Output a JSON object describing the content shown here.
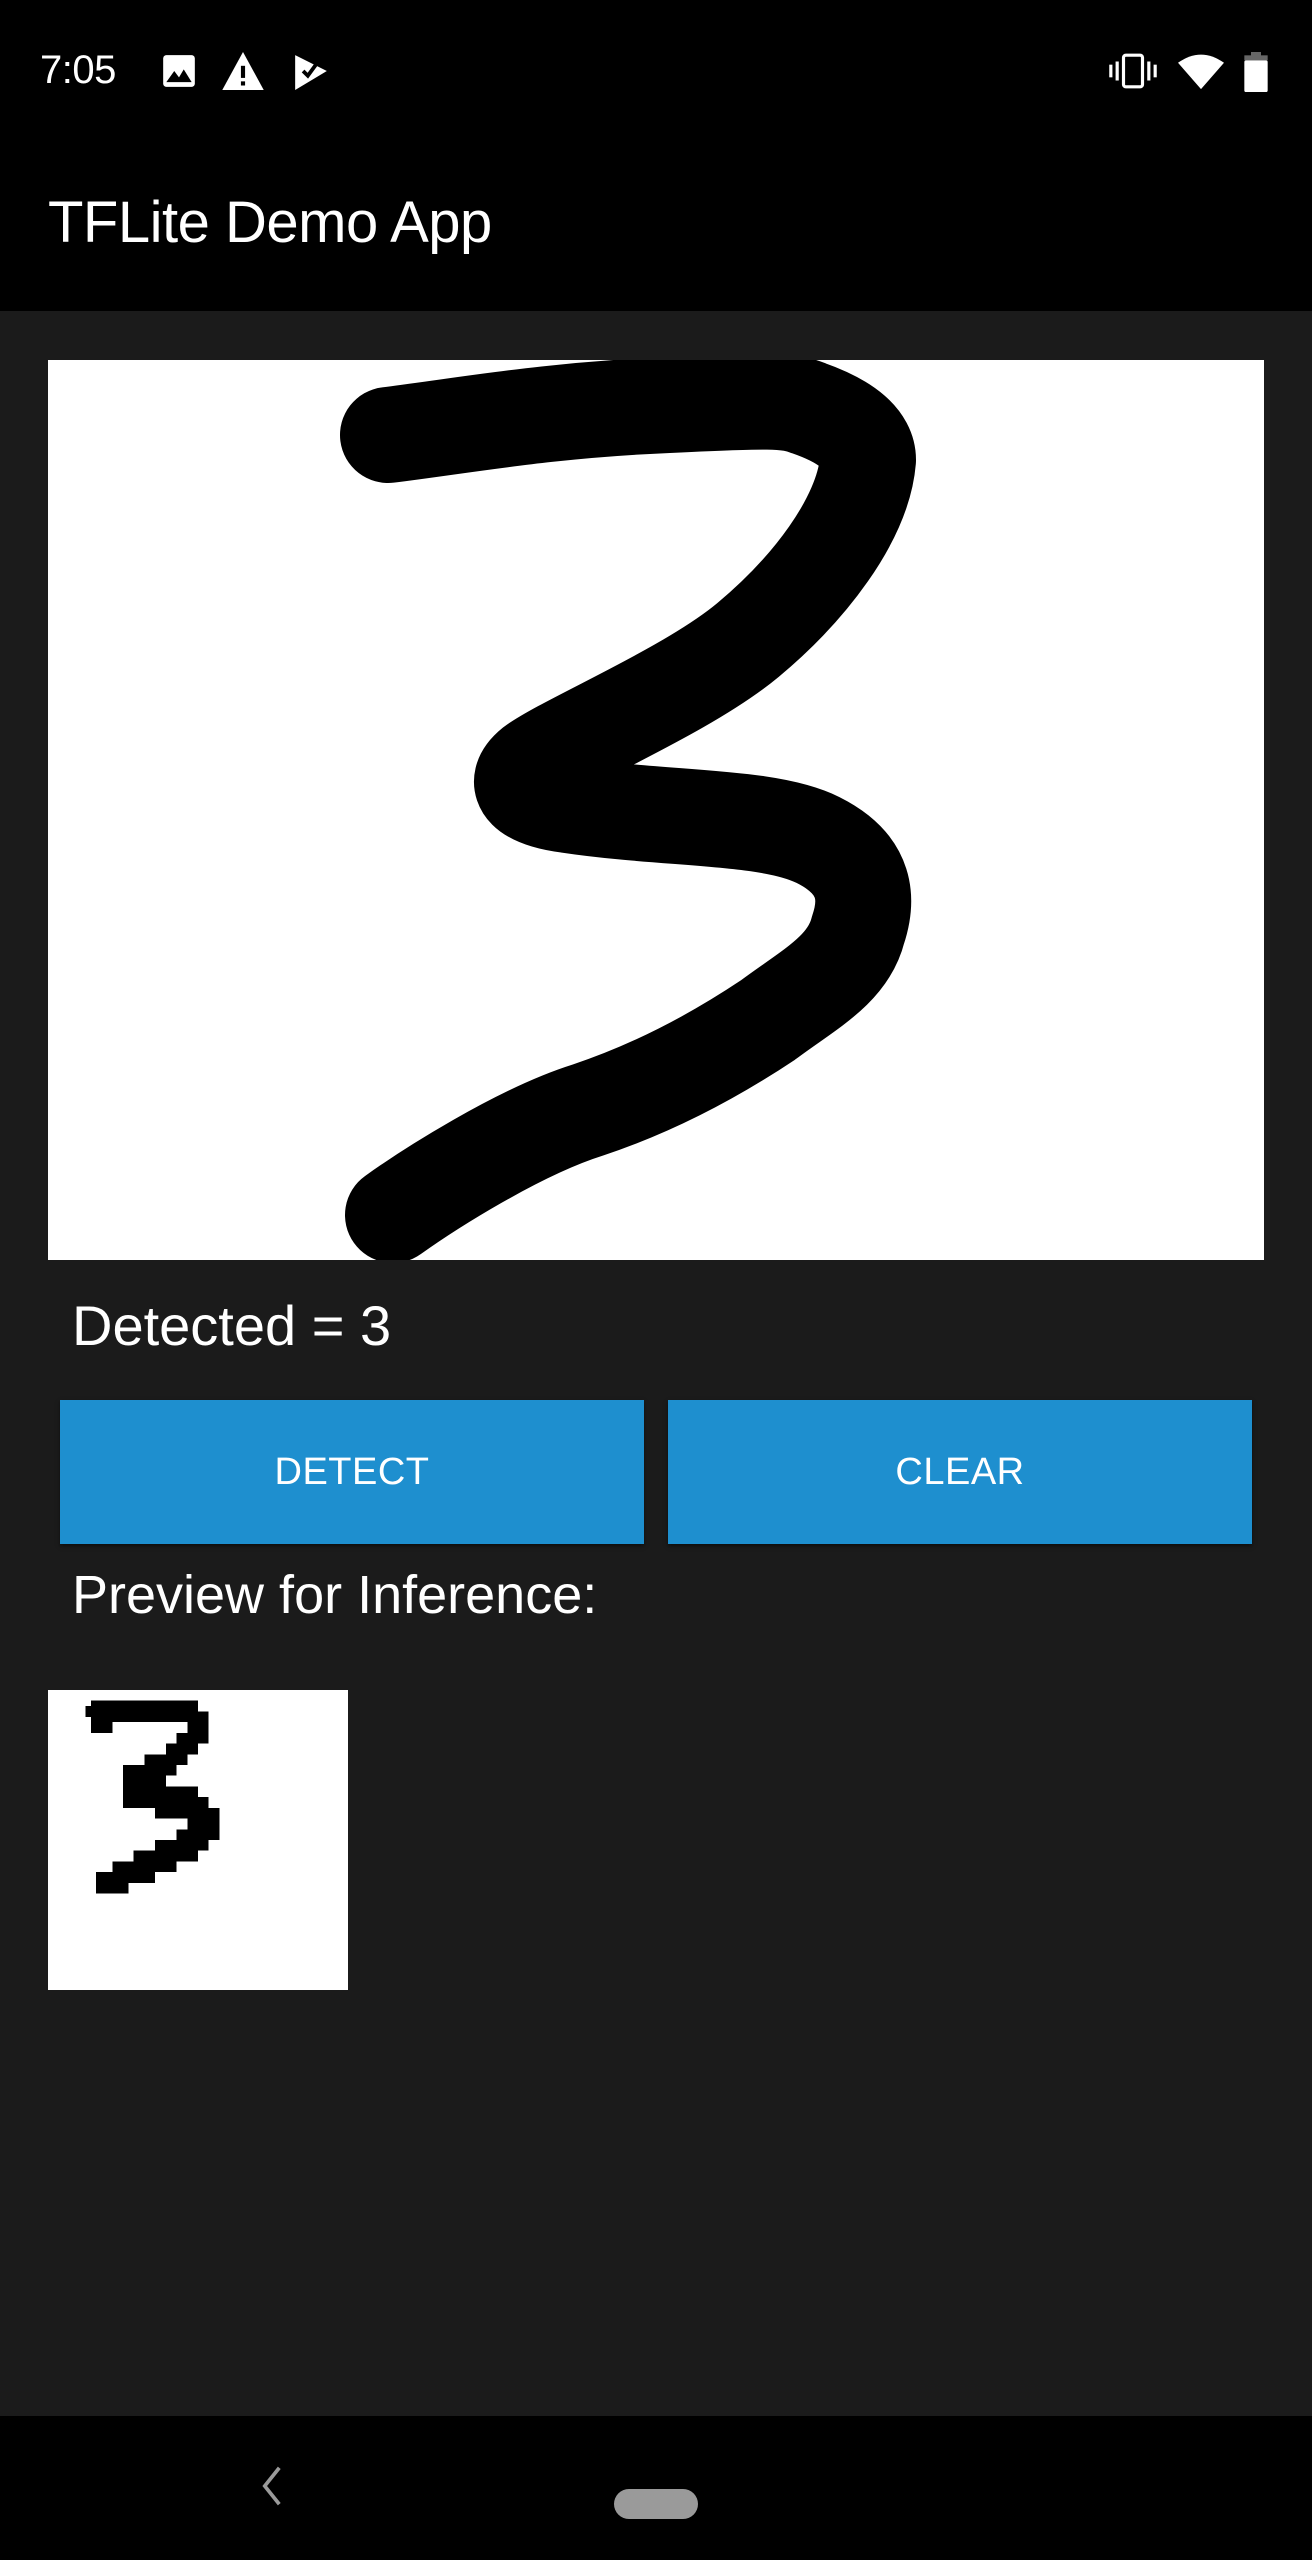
{
  "status_bar": {
    "time": "7:05",
    "left_icons": [
      "image-icon",
      "warning-icon",
      "play-check-icon"
    ],
    "right_icons": [
      "vibrate-icon",
      "wifi-icon",
      "battery-icon"
    ]
  },
  "app_bar": {
    "title": "TFLite Demo App"
  },
  "canvas": {
    "drawn_digit": "3"
  },
  "result": {
    "detected_text": "Detected = 3",
    "detected_value": 3
  },
  "buttons": {
    "detect_label": "DETECT",
    "clear_label": "CLEAR"
  },
  "preview": {
    "label": "Preview for Inference:",
    "digit": "3"
  },
  "nav_bar": {
    "icons": [
      "back-icon",
      "home-pill-icon"
    ]
  },
  "colors": {
    "button": "#1e8fcf",
    "background": "#1b1b1b",
    "bars": "#000000"
  }
}
